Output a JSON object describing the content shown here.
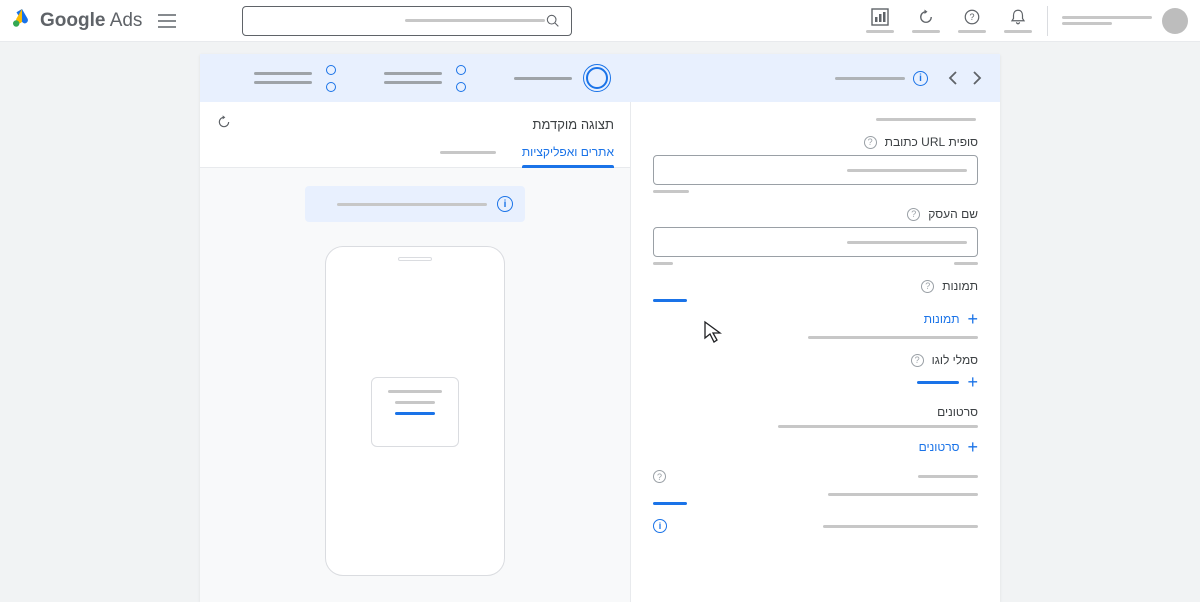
{
  "header": {
    "brand_google": "Google",
    "brand_ads": "Ads",
    "search_placeholder": ""
  },
  "form": {
    "url_suffix_label": "סופית URL כתובת",
    "business_name_label": "שם העסק",
    "images_label": "תמונות",
    "add_images_label": "תמונות",
    "logos_label": "סמלי לוגו",
    "videos_label": "סרטונים",
    "add_videos_label": "סרטונים"
  },
  "preview": {
    "title": "תצוגה מוקדמת",
    "tab_sites_apps": "אתרים ואפליקציות",
    "tab_other": ""
  }
}
